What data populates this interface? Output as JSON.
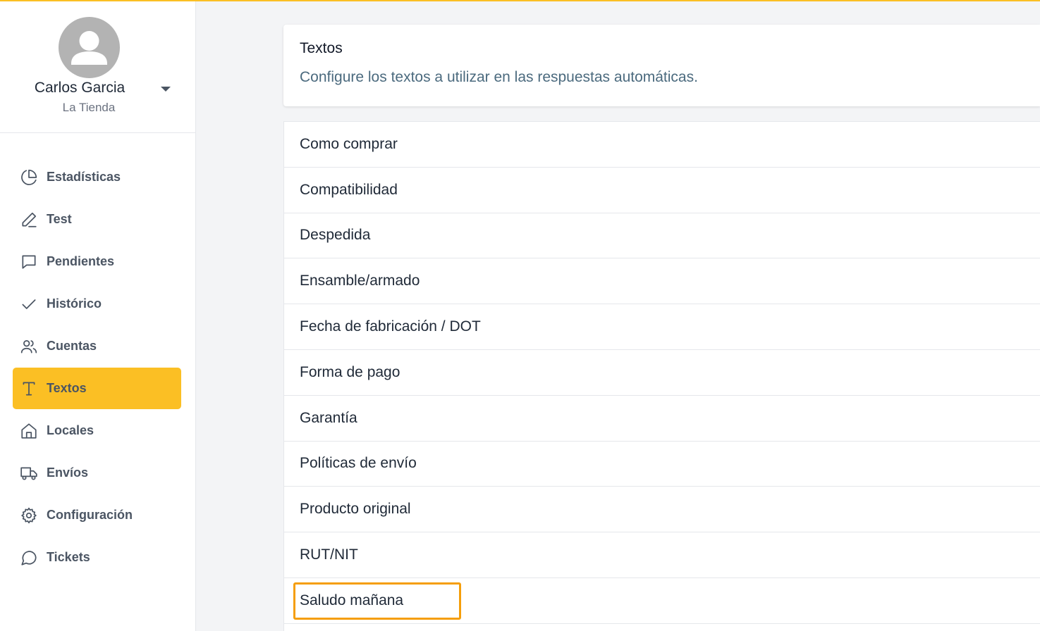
{
  "user": {
    "name": "Carlos Garcia",
    "store": "La Tienda"
  },
  "sidebar": {
    "items": [
      {
        "label": "Estadísticas",
        "icon": "pie-chart-icon"
      },
      {
        "label": "Test",
        "icon": "pencil-icon"
      },
      {
        "label": "Pendientes",
        "icon": "message-square-icon"
      },
      {
        "label": "Histórico",
        "icon": "check-icon"
      },
      {
        "label": "Cuentas",
        "icon": "users-icon"
      },
      {
        "label": "Textos",
        "icon": "type-icon",
        "active": true
      },
      {
        "label": "Locales",
        "icon": "home-icon"
      },
      {
        "label": "Envíos",
        "icon": "truck-icon"
      },
      {
        "label": "Configuración",
        "icon": "gear-icon"
      },
      {
        "label": "Tickets",
        "icon": "message-circle-icon"
      }
    ]
  },
  "header": {
    "title": "Textos",
    "description": "Configure los textos a utilizar en las respuestas automáticas."
  },
  "texts": {
    "items": [
      "Como comprar",
      "Compatibilidad",
      "Despedida",
      "Ensamble/armado",
      "Fecha de fabricación / DOT",
      "Forma de pago",
      "Garantía",
      "Políticas de envío",
      "Producto original",
      "RUT/NIT",
      "Saludo mañana"
    ]
  },
  "colors": {
    "accent": "#fbbf24",
    "highlight_border": "#f59e0b"
  }
}
